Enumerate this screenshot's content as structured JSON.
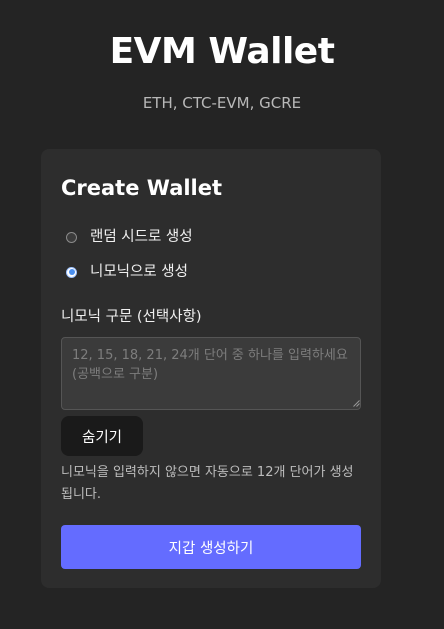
{
  "header": {
    "title": "EVM Wallet",
    "subtitle": "ETH, CTC-EVM, GCRE"
  },
  "card": {
    "title": "Create Wallet",
    "options": [
      {
        "label": "랜덤 시드로 생성",
        "selected": false
      },
      {
        "label": "니모닉으로 생성",
        "selected": true
      }
    ],
    "mnemonic_label": "니모닉 구문 (선택사항)",
    "mnemonic_value": "",
    "mnemonic_placeholder": "12, 15, 18, 21, 24개 단어 중 하나를 입력하세요 (공백으로 구분)",
    "hide_label": "숨기기",
    "help_text": "니모닉을 입력하지 않으면 자동으로 12개 단어가 생성됩니다.",
    "create_label": "지갑 생성하기"
  },
  "colors": {
    "background": "#242424",
    "card": "#2d2d2d",
    "accent": "#646cff",
    "radio_checked": "#4a8ff0"
  }
}
